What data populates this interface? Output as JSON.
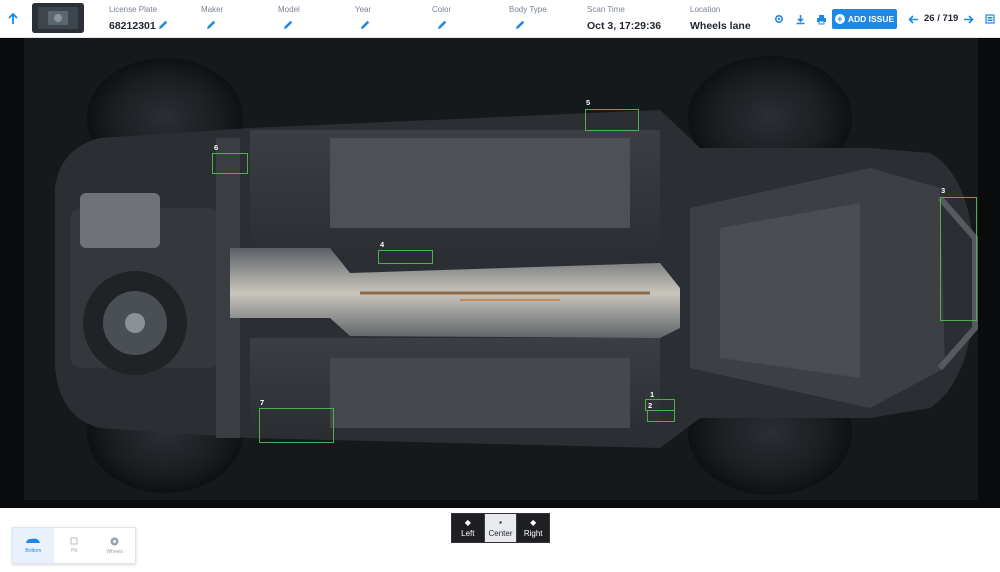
{
  "header": {
    "license_plate": {
      "label": "License Plate",
      "value": "68212301"
    },
    "maker": {
      "label": "Maker",
      "value": ""
    },
    "model": {
      "label": "Model",
      "value": ""
    },
    "year": {
      "label": "Year",
      "value": ""
    },
    "color": {
      "label": "Color",
      "value": ""
    },
    "body_type": {
      "label": "Body Type",
      "value": ""
    },
    "scan_time": {
      "label": "Scan Time",
      "value": "Oct 3, 17:29:36"
    },
    "location": {
      "label": "Location",
      "value": "Wheels lane"
    },
    "add_issue_label": "ADD ISSUE",
    "pager": "26 / 719"
  },
  "detections": [
    "1",
    "2",
    "3",
    "4",
    "5",
    "6",
    "7"
  ],
  "view_switch": {
    "left": "Left",
    "center": "Center",
    "right": "Right"
  },
  "mode_bar": {
    "bottom": "Bottom",
    "pit": "Pit",
    "wheels": "Wheels"
  },
  "colors": {
    "accent": "#1e88e5",
    "detection_box": "#4caf50",
    "viewer_bg": "#0a0b0d"
  },
  "icons": [
    "arrow-up-icon",
    "pencil-icon",
    "settings-icon",
    "download-icon",
    "print-icon",
    "plus-icon",
    "arrow-left-icon",
    "arrow-right-icon",
    "list-icon",
    "car-bottom-icon",
    "pit-icon",
    "wheel-icon"
  ]
}
